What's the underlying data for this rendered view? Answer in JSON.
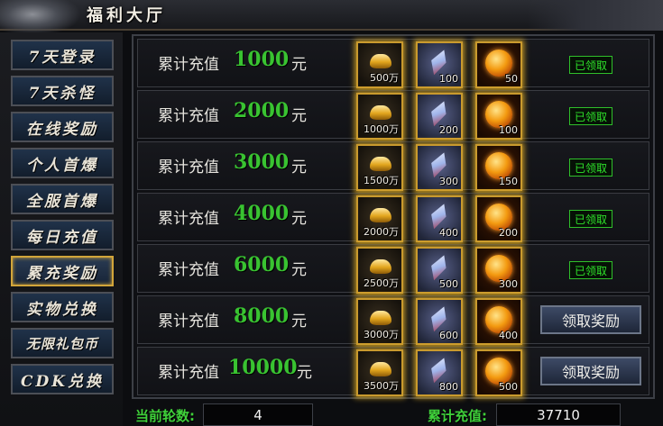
{
  "title": "福利大厅",
  "sidebar": {
    "items": [
      {
        "label": "7天登录"
      },
      {
        "label": "7天杀怪"
      },
      {
        "label": "在线奖励"
      },
      {
        "label": "个人首爆"
      },
      {
        "label": "全服首爆"
      },
      {
        "label": "每日充值"
      },
      {
        "label": "累充奖励"
      },
      {
        "label": "实物兑换"
      },
      {
        "label": "无限礼包币"
      },
      {
        "label": "CDK兑换"
      }
    ]
  },
  "rows": [
    {
      "label": "累计充值",
      "amount": "1000",
      "unit": "元",
      "gold": "500万",
      "crystal": "100",
      "orb": "50",
      "status": "已领取"
    },
    {
      "label": "累计充值",
      "amount": "2000",
      "unit": "元",
      "gold": "1000万",
      "crystal": "200",
      "orb": "100",
      "status": "已领取"
    },
    {
      "label": "累计充值",
      "amount": "3000",
      "unit": "元",
      "gold": "1500万",
      "crystal": "300",
      "orb": "150",
      "status": "已领取"
    },
    {
      "label": "累计充值",
      "amount": "4000",
      "unit": "元",
      "gold": "2000万",
      "crystal": "400",
      "orb": "200",
      "status": "已领取"
    },
    {
      "label": "累计充值",
      "amount": "6000",
      "unit": "元",
      "gold": "2500万",
      "crystal": "500",
      "orb": "300",
      "status": "已领取"
    },
    {
      "label": "累计充值",
      "amount": "8000",
      "unit": "元",
      "gold": "3000万",
      "crystal": "600",
      "orb": "400",
      "status": "领取奖励"
    },
    {
      "label": "累计充值",
      "amount": "10000",
      "unit": "元",
      "gold": "3500万",
      "crystal": "800",
      "orb": "500",
      "status": "领取奖励"
    }
  ],
  "footer": {
    "round_label": "当前轮数:",
    "round_value": "4",
    "total_label": "累计充值:",
    "total_value": "37710"
  },
  "colors": {
    "amount_green": "#39c331",
    "claimed_green": "#2ee12a",
    "active_border": "#d2a53a",
    "item_glow": "#ffc428"
  }
}
